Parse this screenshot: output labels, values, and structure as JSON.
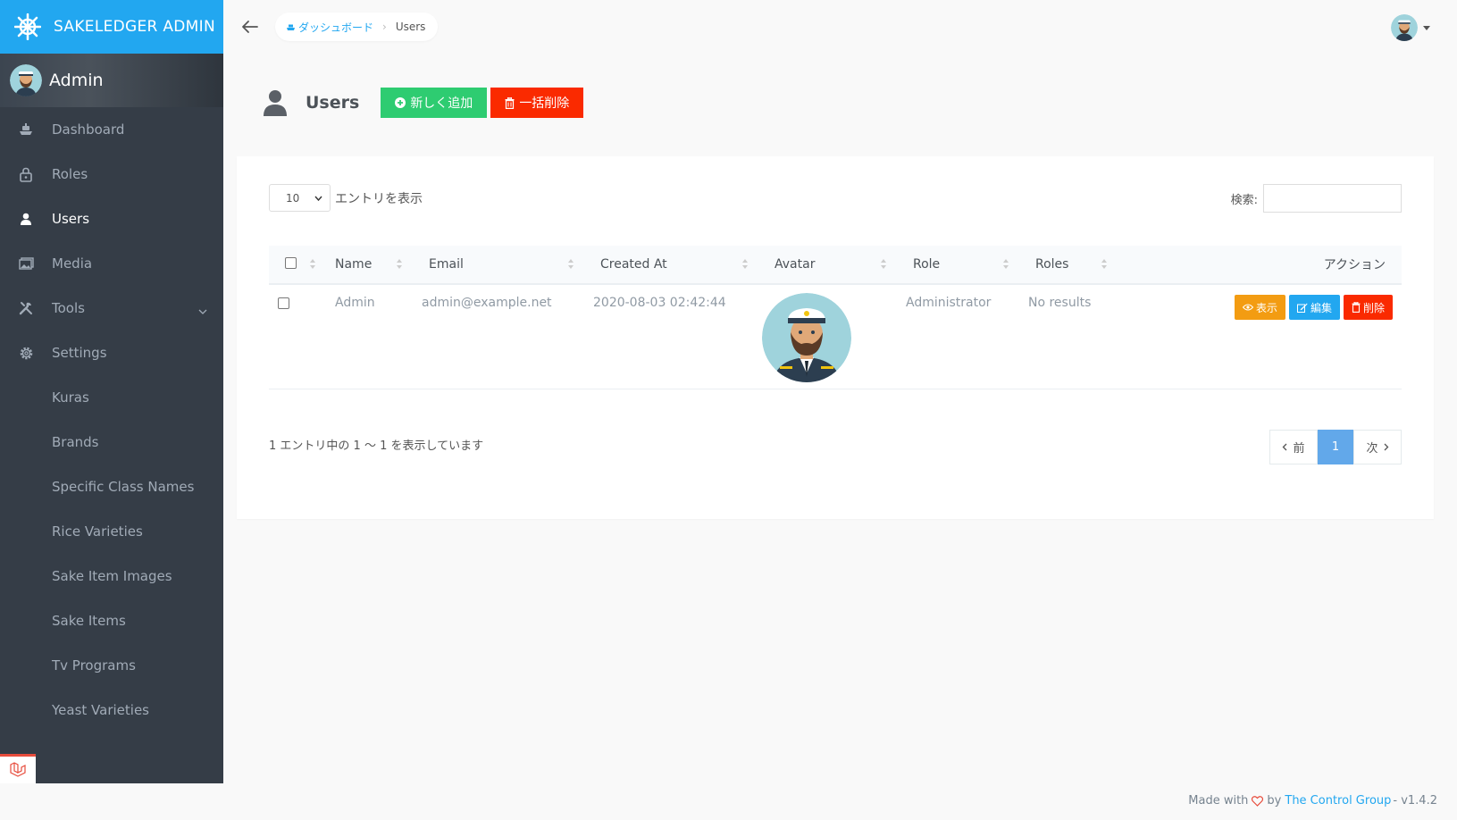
{
  "brand": {
    "title": "SAKELEDGER ADMIN",
    "logo_icon": "ship-wheel-icon"
  },
  "profile": {
    "name": "Admin"
  },
  "sidebar": {
    "items": [
      {
        "label": "Dashboard",
        "icon": "boat-icon"
      },
      {
        "label": "Roles",
        "icon": "lock-icon"
      },
      {
        "label": "Users",
        "icon": "person-icon",
        "active": true
      },
      {
        "label": "Media",
        "icon": "images-icon"
      },
      {
        "label": "Tools",
        "icon": "tools-icon",
        "expandable": true
      },
      {
        "label": "Settings",
        "icon": "gear-icon"
      }
    ],
    "sub_items": [
      "Kuras",
      "Brands",
      "Specific Class Names",
      "Rice Varieties",
      "Sake Item Images",
      "Sake Items",
      "Tv Programs",
      "Yeast Varieties"
    ]
  },
  "breadcrumb": {
    "home": "ダッシュボード",
    "current": "Users"
  },
  "page": {
    "title": "Users",
    "add_label": "新しく追加",
    "bulk_delete_label": "一括削除"
  },
  "table_controls": {
    "length_value": "10",
    "length_label": "エントリを表示",
    "search_label": "検索:",
    "search_value": ""
  },
  "table": {
    "columns": [
      "Name",
      "Email",
      "Created At",
      "Avatar",
      "Role",
      "Roles",
      "アクション"
    ],
    "rows": [
      {
        "name": "Admin",
        "email": "admin@example.net",
        "created_at": "2020-08-03 02:42:44",
        "role": "Administrator",
        "roles": "No results",
        "actions": {
          "view": "表示",
          "edit": "編集",
          "delete": "削除"
        }
      }
    ]
  },
  "info": "1 エントリ中の 1 〜 1 を表示しています",
  "pagination": {
    "prev": "前",
    "current": "1",
    "next": "次"
  },
  "footer": {
    "made_with": "Made with",
    "by": "by",
    "link": "The Control Group",
    "version": "- v1.4.2"
  },
  "colors": {
    "accent": "#22a7f0",
    "success": "#2ecc71",
    "danger": "#fa2a00",
    "warning": "#f39c12",
    "sidebar": "#353d47"
  }
}
